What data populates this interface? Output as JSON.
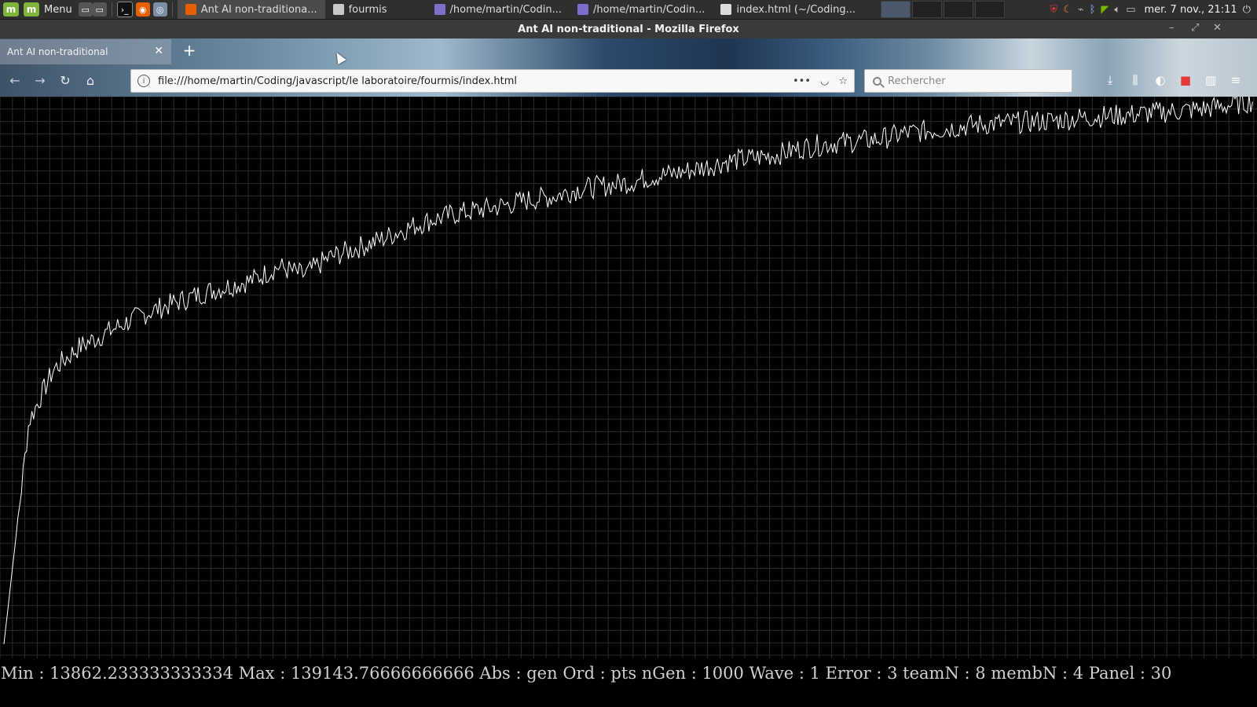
{
  "taskbar": {
    "menu_label": "Menu",
    "tasks": [
      {
        "label": "Ant AI non-traditiona...",
        "active": true
      },
      {
        "label": "fourmis",
        "active": false
      },
      {
        "label": "/home/martin/Codin...",
        "active": false
      },
      {
        "label": "/home/martin/Codin...",
        "active": false
      },
      {
        "label": "index.html (~/Coding...",
        "active": false
      }
    ],
    "clock": "mer. 7 nov., 21:11"
  },
  "window": {
    "title": "Ant AI non-traditional - Mozilla Firefox"
  },
  "browser": {
    "tab_title": "Ant AI non-traditional",
    "url": "file:///home/martin/Coding/javascript/le laboratoire/fourmis/index.html",
    "search_placeholder": "Rechercher"
  },
  "status_line": "Min : 13862.233333333334 Max : 139143.76666666666 Abs : gen Ord : pts nGen : 1000 Wave : 1 Error : 3 teamN : 8 membN : 4 Panel : 30",
  "chart_data": {
    "type": "line",
    "title": "",
    "xlabel": "gen",
    "ylabel": "pts",
    "xlim": [
      0,
      1000
    ],
    "ylim": [
      13862.233333333334,
      139143.76666666666
    ],
    "grid": true,
    "line_color": "#ffffff",
    "grid_color": "#2a2a2a",
    "series": [
      {
        "x": [
          0,
          20,
          40,
          60,
          80,
          100,
          120,
          140,
          160,
          180,
          200,
          220,
          240,
          260,
          280,
          300,
          320,
          340,
          360,
          380,
          400,
          420,
          440,
          460,
          480,
          500,
          520,
          540,
          560,
          580,
          600,
          620,
          640,
          660,
          680,
          700,
          720,
          740,
          760,
          780,
          800,
          820,
          840,
          860,
          880,
          900,
          920,
          940,
          960,
          980,
          1000
        ],
        "y": [
          13862,
          65000,
          77000,
          82000,
          85000,
          88000,
          90500,
          92500,
          94500,
          96000,
          97500,
          100500,
          98500,
          102500,
          104500,
          106500,
          109000,
          111000,
          112500,
          113500,
          114500,
          115800,
          116600,
          118300,
          119000,
          119800,
          121200,
          122000,
          123300,
          124700,
          125400,
          126300,
          127800,
          128700,
          129200,
          129700,
          131000,
          131700,
          132400,
          133100,
          133400,
          133700,
          134000,
          134600,
          135000,
          135300,
          135800,
          136200,
          136700,
          137500,
          138500
        ]
      }
    ]
  }
}
